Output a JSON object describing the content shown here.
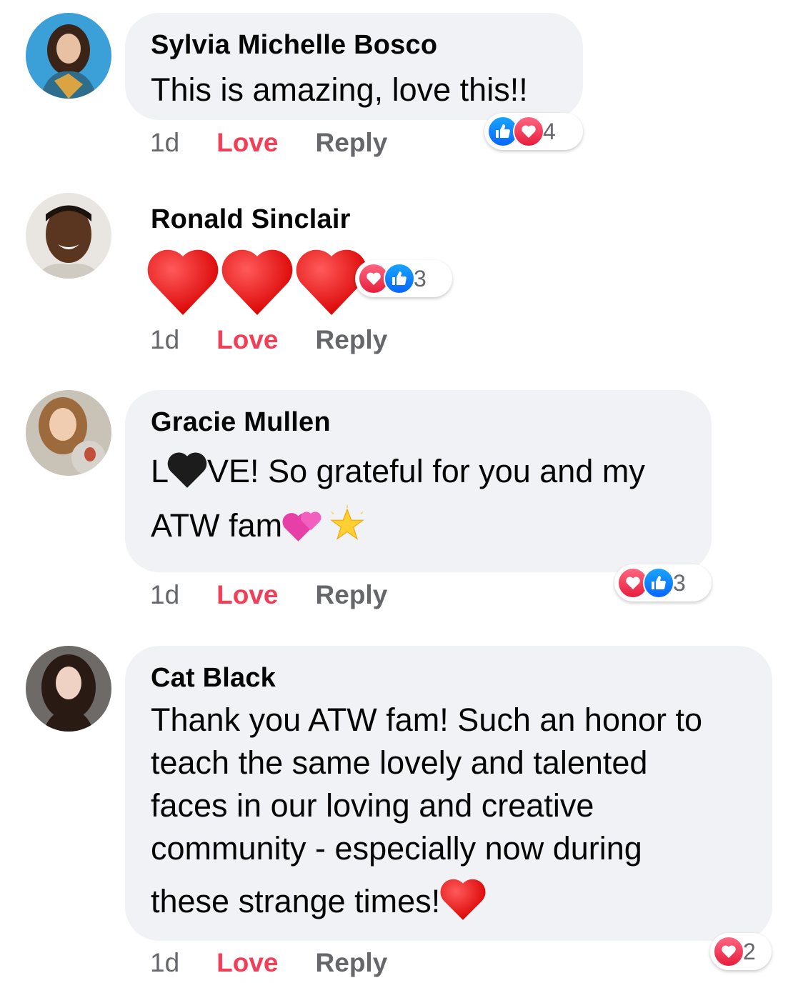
{
  "comments": [
    {
      "author": "Sylvia Michelle Bosco",
      "text": "This is amazing, love this!!",
      "time": "1d",
      "love_label": "Love",
      "reply_label": "Reply",
      "reaction_count": "4",
      "reactions": [
        "like-icon",
        "love-icon"
      ]
    },
    {
      "author": "Ronald Sinclair",
      "text": "❤️❤️❤️",
      "time": "1d",
      "love_label": "Love",
      "reply_label": "Reply",
      "reaction_count": "3",
      "reactions": [
        "love-icon",
        "like-icon"
      ]
    },
    {
      "author": "Gracie Mullen",
      "text_line1_a": "L",
      "text_line1_b": "VE! So grateful for you and my",
      "text_line2": "ATW fam",
      "time": "1d",
      "love_label": "Love",
      "reply_label": "Reply",
      "reaction_count": "3",
      "reactions": [
        "love-icon",
        "like-icon"
      ]
    },
    {
      "author": "Cat Black",
      "text_lines": [
        "Thank you ATW fam! Such an honor to",
        "teach the same lovely and talented",
        "faces in our loving and creative",
        "community - especially now during",
        "these strange times!"
      ],
      "time": "1d",
      "love_label": "Love",
      "reply_label": "Reply",
      "reaction_count": "2",
      "reactions": [
        "love-icon"
      ]
    }
  ],
  "colors": {
    "bubble": "#f0f2f5",
    "love_text": "#f33e58",
    "secondary_text": "#65676b",
    "like_blue": "#0866ff",
    "love_red": "#f33e58"
  }
}
